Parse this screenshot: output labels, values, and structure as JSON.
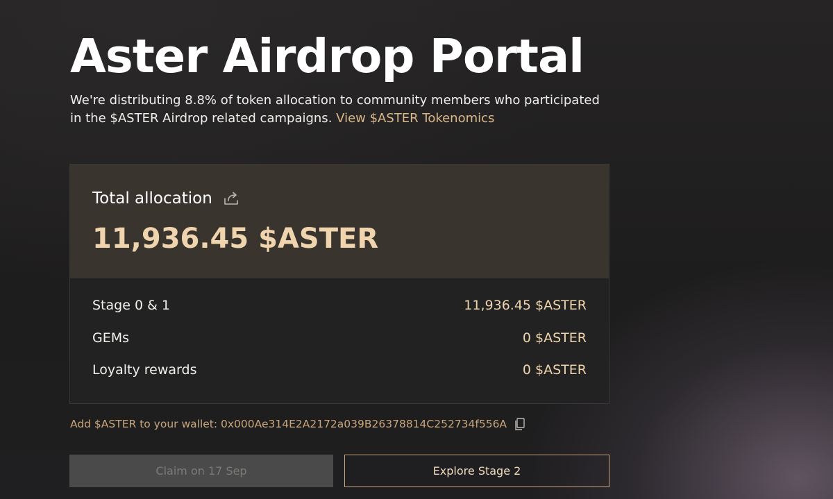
{
  "header": {
    "title": "Aster Airdrop Portal",
    "intro_line1": "We're distributing 8.8% of token allocation to community members who participated",
    "intro_line2": "in the $ASTER Airdrop related campaigns.",
    "tokenomics_link": "View $ASTER Tokenomics"
  },
  "allocation": {
    "label": "Total allocation",
    "share_icon": "share-icon",
    "amount": "11,936.45 $ASTER",
    "breakdown": [
      {
        "label": "Stage 0 & 1",
        "value": "11,936.45 $ASTER"
      },
      {
        "label": "GEMs",
        "value": "0 $ASTER"
      },
      {
        "label": "Loyalty rewards",
        "value": "0 $ASTER"
      }
    ]
  },
  "wallet": {
    "text": "Add $ASTER to your wallet: 0x000Ae314E2A2172a039B26378814C252734f556A",
    "copy_icon": "copy-icon"
  },
  "actions": {
    "claim_label": "Claim on 17 Sep",
    "explore_label": "Explore Stage 2"
  },
  "colors": {
    "accent": "#efd4ad",
    "link": "#d9b88a",
    "card_top": "#3a342f",
    "card_bottom": "#222222",
    "button_border": "#c9a67c"
  }
}
